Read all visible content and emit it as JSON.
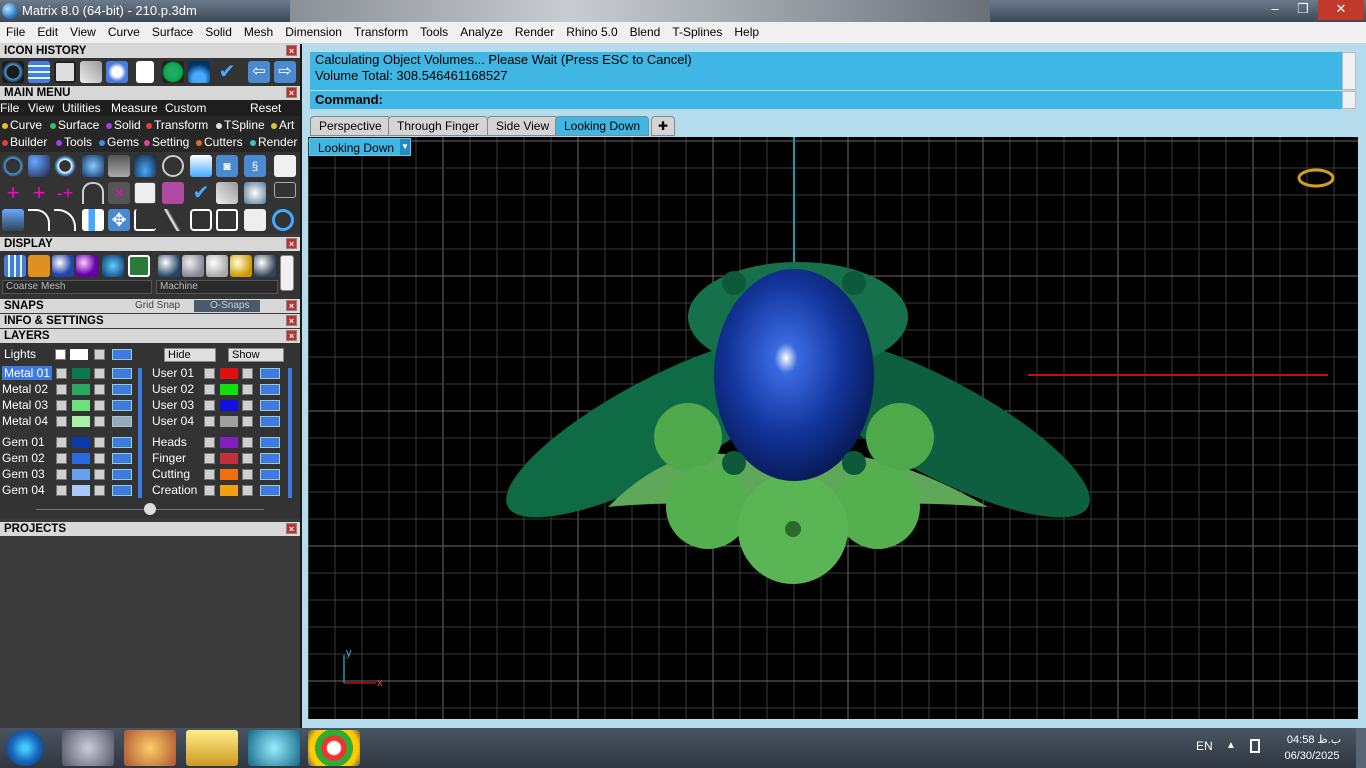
{
  "window": {
    "title": "Matrix 8.0 (64-bit) - 210.p.3dm",
    "min": "–",
    "max": "❐",
    "close": "✕"
  },
  "menubar": [
    "File",
    "Edit",
    "View",
    "Curve",
    "Surface",
    "Solid",
    "Mesh",
    "Dimension",
    "Transform",
    "Tools",
    "Analyze",
    "Render",
    "Rhino 5.0",
    "Blend",
    "T-Splines",
    "Help"
  ],
  "panels": {
    "icon_history": "ICON HISTORY",
    "main_menu": "MAIN MENU",
    "display": "DISPLAY",
    "snaps": "SNAPS",
    "grid_snap": "Grid Snap",
    "osnaps": "O-Snaps",
    "info": "INFO & SETTINGS",
    "layers": "LAYERS",
    "projects": "PROJECTS"
  },
  "main_menu": {
    "file": "File",
    "view": "View",
    "utilities": "Utilities",
    "measure": "Measure",
    "custom": "Custom",
    "reset": "Reset",
    "cats1": [
      {
        "label": "Curve",
        "color": "#e0c030"
      },
      {
        "label": "Surface",
        "color": "#30c070"
      },
      {
        "label": "Solid",
        "color": "#a040e0"
      },
      {
        "label": "Transform",
        "color": "#e04040"
      },
      {
        "label": "TSpline",
        "color": "#e0e0e0"
      },
      {
        "label": "Art",
        "color": "#e0c030"
      }
    ],
    "cats2": [
      {
        "label": "Builder",
        "color": "#e04040"
      },
      {
        "label": "Tools",
        "color": "#a040e0"
      },
      {
        "label": "Gems",
        "color": "#4090e0"
      },
      {
        "label": "Setting",
        "color": "#e040a0"
      },
      {
        "label": "Cutters",
        "color": "#e07020"
      },
      {
        "label": "Render",
        "color": "#40c0c0"
      }
    ]
  },
  "display": {
    "mesh": "Coarse Mesh",
    "material": "Machine"
  },
  "layers": {
    "lights": "Lights",
    "hide": "Hide",
    "show": "Show",
    "left": [
      {
        "name": "Metal 01",
        "color": "#0a7a4a",
        "selected": true
      },
      {
        "name": "Metal 02",
        "color": "#2aa860"
      },
      {
        "name": "Metal 03",
        "color": "#6de07a"
      },
      {
        "name": "Metal 04",
        "color": "#a8f0a8"
      },
      {
        "name": "Gem 01",
        "color": "#0a3aa8"
      },
      {
        "name": "Gem 02",
        "color": "#2a6ae0"
      },
      {
        "name": "Gem 03",
        "color": "#6aa0f0"
      },
      {
        "name": "Gem 04",
        "color": "#a8c8f8"
      }
    ],
    "right": [
      {
        "name": "User 01",
        "color": "#e01010"
      },
      {
        "name": "User 02",
        "color": "#10e010"
      },
      {
        "name": "User 03",
        "color": "#1010e0"
      },
      {
        "name": "User 04",
        "color": "#a0a0a0"
      },
      {
        "name": "Heads",
        "color": "#8020c0"
      },
      {
        "name": "Finger",
        "color": "#c03040"
      },
      {
        "name": "Cutting",
        "color": "#f07010"
      },
      {
        "name": "Creation",
        "color": "#f0a010"
      }
    ]
  },
  "command": {
    "line1": "Calculating Object Volumes... Please Wait (Press ESC to Cancel)",
    "line2": "Volume Total: 308.546461168527",
    "prompt": "Command:"
  },
  "tabs": [
    "Perspective",
    "Through Finger",
    "Side View",
    "Looking Down"
  ],
  "active_tab": "Looking Down",
  "tab_add": "✚",
  "viewport": {
    "label": "Looking Down",
    "axis_y": "y",
    "axis_x": "x"
  },
  "taskbar": {
    "lang": "EN",
    "time": "04:58 ب.ظ",
    "date": "06/30/2025"
  }
}
